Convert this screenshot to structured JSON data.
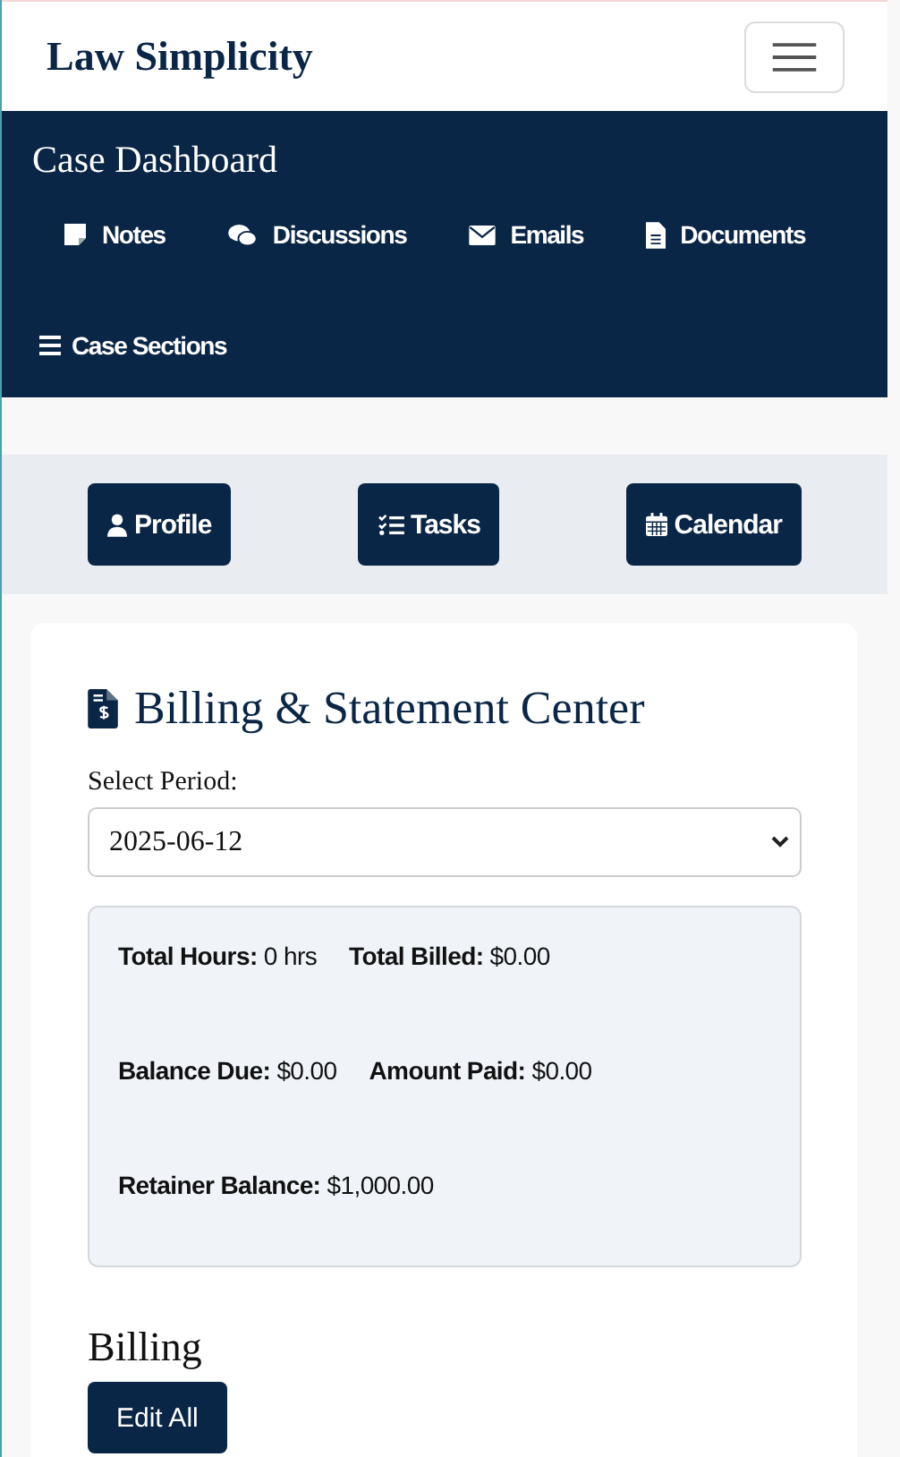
{
  "brand": "Law Simplicity",
  "header": {
    "title": "Case Dashboard",
    "nav": [
      {
        "label": "Notes"
      },
      {
        "label": "Discussions"
      },
      {
        "label": "Emails"
      },
      {
        "label": "Documents"
      },
      {
        "label": "Case Sections"
      }
    ]
  },
  "actions": [
    {
      "label": "Profile"
    },
    {
      "label": "Tasks"
    },
    {
      "label": "Calendar"
    }
  ],
  "billing_center": {
    "title": "Billing & Statement Center",
    "period_label": "Select Period:",
    "period_value": "2025-06-12",
    "stats": [
      [
        "**Total Hours:** 0 hrs",
        "**Total Billed:** $0.00"
      ],
      [
        "**Balance Due:** $0.00",
        "**Amount Paid:** $0.00"
      ],
      [
        "**Retainer Balance:** $1,000.00"
      ]
    ]
  },
  "billing": {
    "title": "Billing",
    "button": "Edit All"
  }
}
